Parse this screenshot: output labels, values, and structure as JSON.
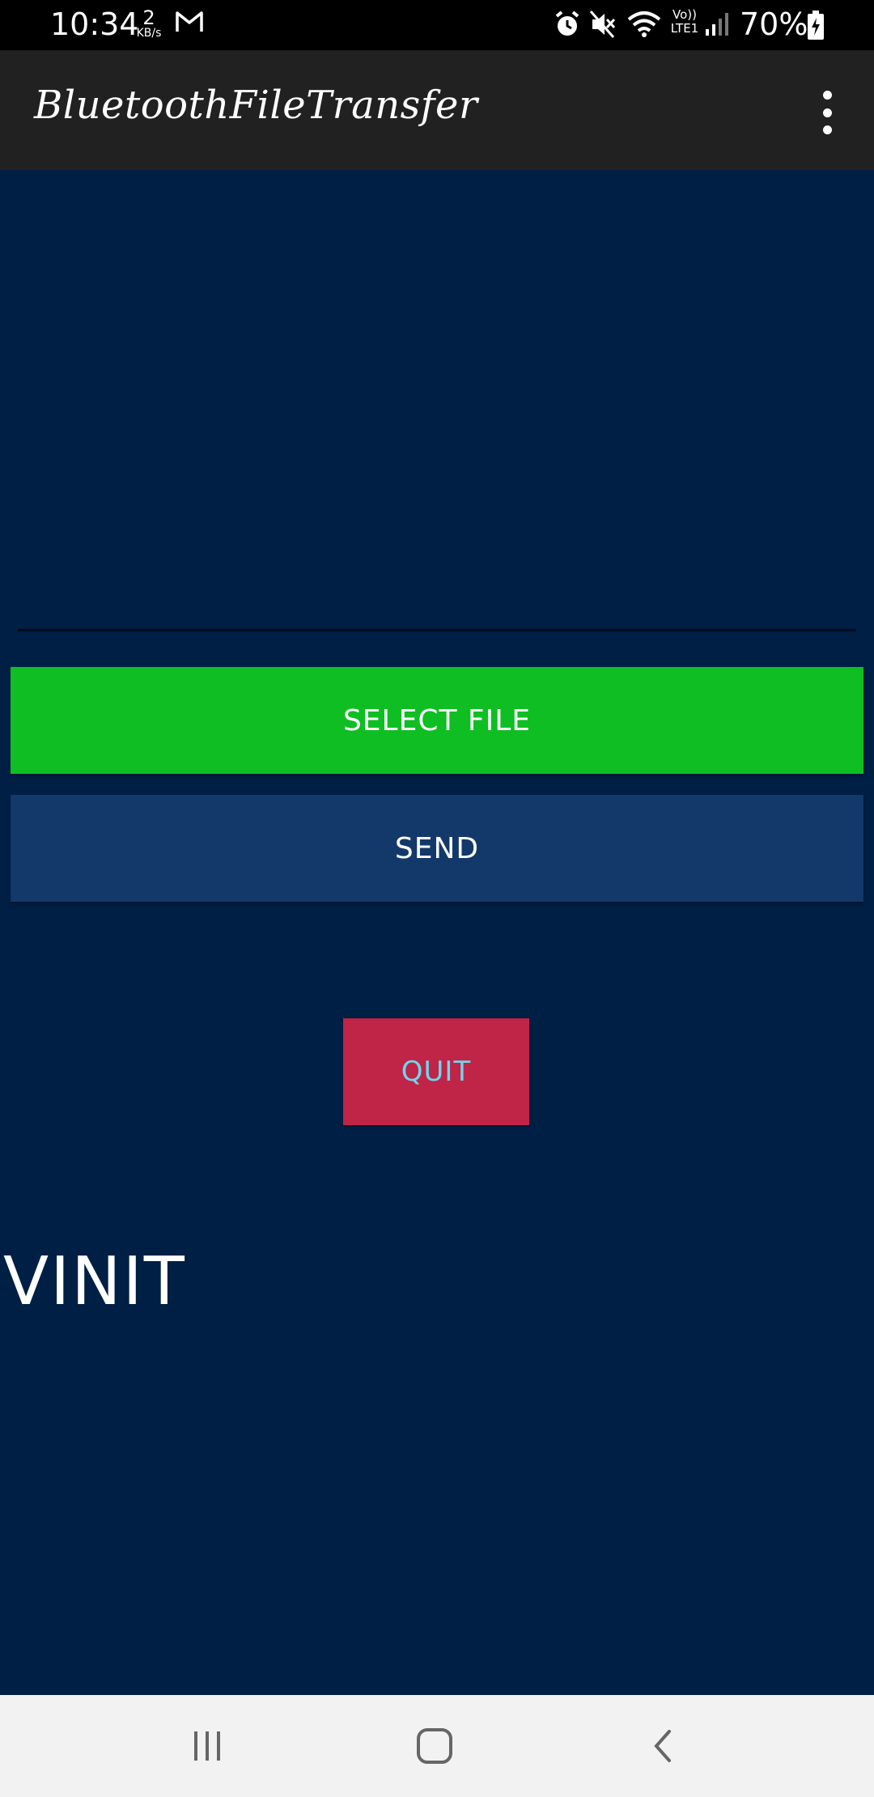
{
  "status_bar": {
    "time": "10:34",
    "speed_value": "2",
    "speed_unit": "KB/s",
    "network_label_top": "Vo))",
    "network_label_bottom": "LTE1",
    "battery_percent": "70%"
  },
  "app_bar": {
    "title": "BluetoothFileTransfer",
    "menu_icon": "more-vert-icon"
  },
  "main": {
    "file_input_value": "",
    "select_file_label": "SELECT FILE",
    "send_label": "SEND",
    "quit_label": "QUIT",
    "name_text": "VINIT"
  },
  "nav_bar": {
    "recents_icon": "recents-icon",
    "home_icon": "home-icon",
    "back_icon": "back-icon"
  },
  "colors": {
    "background": "#001f45",
    "app_bar": "#212121",
    "select_button": "#0fbe22",
    "send_button": "#13386a",
    "quit_button": "#c02446",
    "quit_text": "#6fd6ee",
    "nav_bar": "#f2f2f2"
  }
}
